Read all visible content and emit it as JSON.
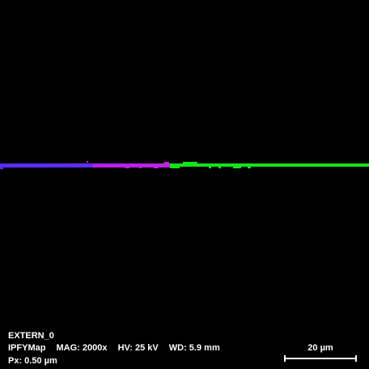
{
  "image": {
    "background": "#000000",
    "band_colors": {
      "left": "#5a2cf0",
      "mid": "#c21ee6",
      "right": "#18e21c"
    }
  },
  "info": {
    "file_name": "EXTERN_0",
    "map_type": "IPFYMap",
    "magnification": "MAG: 2000x",
    "high_voltage": "HV: 25 kV",
    "working_distance": "WD: 5.9 mm",
    "pixel_size": "Px: 0.50 µm"
  },
  "scale_bar": {
    "label": "20 µm"
  }
}
